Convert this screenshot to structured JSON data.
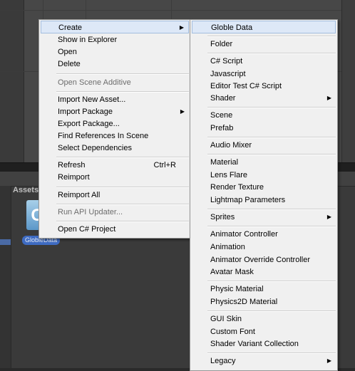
{
  "context_menu": {
    "items": [
      {
        "label": "Create"
      },
      {
        "label": "Show in Explorer"
      },
      {
        "label": "Open"
      },
      {
        "label": "Delete"
      },
      {
        "label": "Open Scene Additive"
      },
      {
        "label": "Import New Asset..."
      },
      {
        "label": "Import Package"
      },
      {
        "label": "Export Package..."
      },
      {
        "label": "Find References In Scene"
      },
      {
        "label": "Select Dependencies"
      },
      {
        "label": "Refresh",
        "shortcut": "Ctrl+R"
      },
      {
        "label": "Reimport"
      },
      {
        "label": "Reimport All"
      },
      {
        "label": "Run API Updater..."
      },
      {
        "label": "Open C# Project"
      }
    ]
  },
  "create_submenu": {
    "items": [
      {
        "label": "Globle Data"
      },
      {
        "label": "Folder"
      },
      {
        "label": "C# Script"
      },
      {
        "label": "Javascript"
      },
      {
        "label": "Editor Test C# Script"
      },
      {
        "label": "Shader"
      },
      {
        "label": "Scene"
      },
      {
        "label": "Prefab"
      },
      {
        "label": "Audio Mixer"
      },
      {
        "label": "Material"
      },
      {
        "label": "Lens Flare"
      },
      {
        "label": "Render Texture"
      },
      {
        "label": "Lightmap Parameters"
      },
      {
        "label": "Sprites"
      },
      {
        "label": "Animator Controller"
      },
      {
        "label": "Animation"
      },
      {
        "label": "Animator Override Controller"
      },
      {
        "label": "Avatar Mask"
      },
      {
        "label": "Physic Material"
      },
      {
        "label": "Physics2D Material"
      },
      {
        "label": "GUI Skin"
      },
      {
        "label": "Custom Font"
      },
      {
        "label": "Shader Variant Collection"
      },
      {
        "label": "Legacy"
      }
    ]
  },
  "project_panel": {
    "label": "Assets",
    "asset_name": "GlobleData",
    "asset_icon_letter": "C"
  }
}
